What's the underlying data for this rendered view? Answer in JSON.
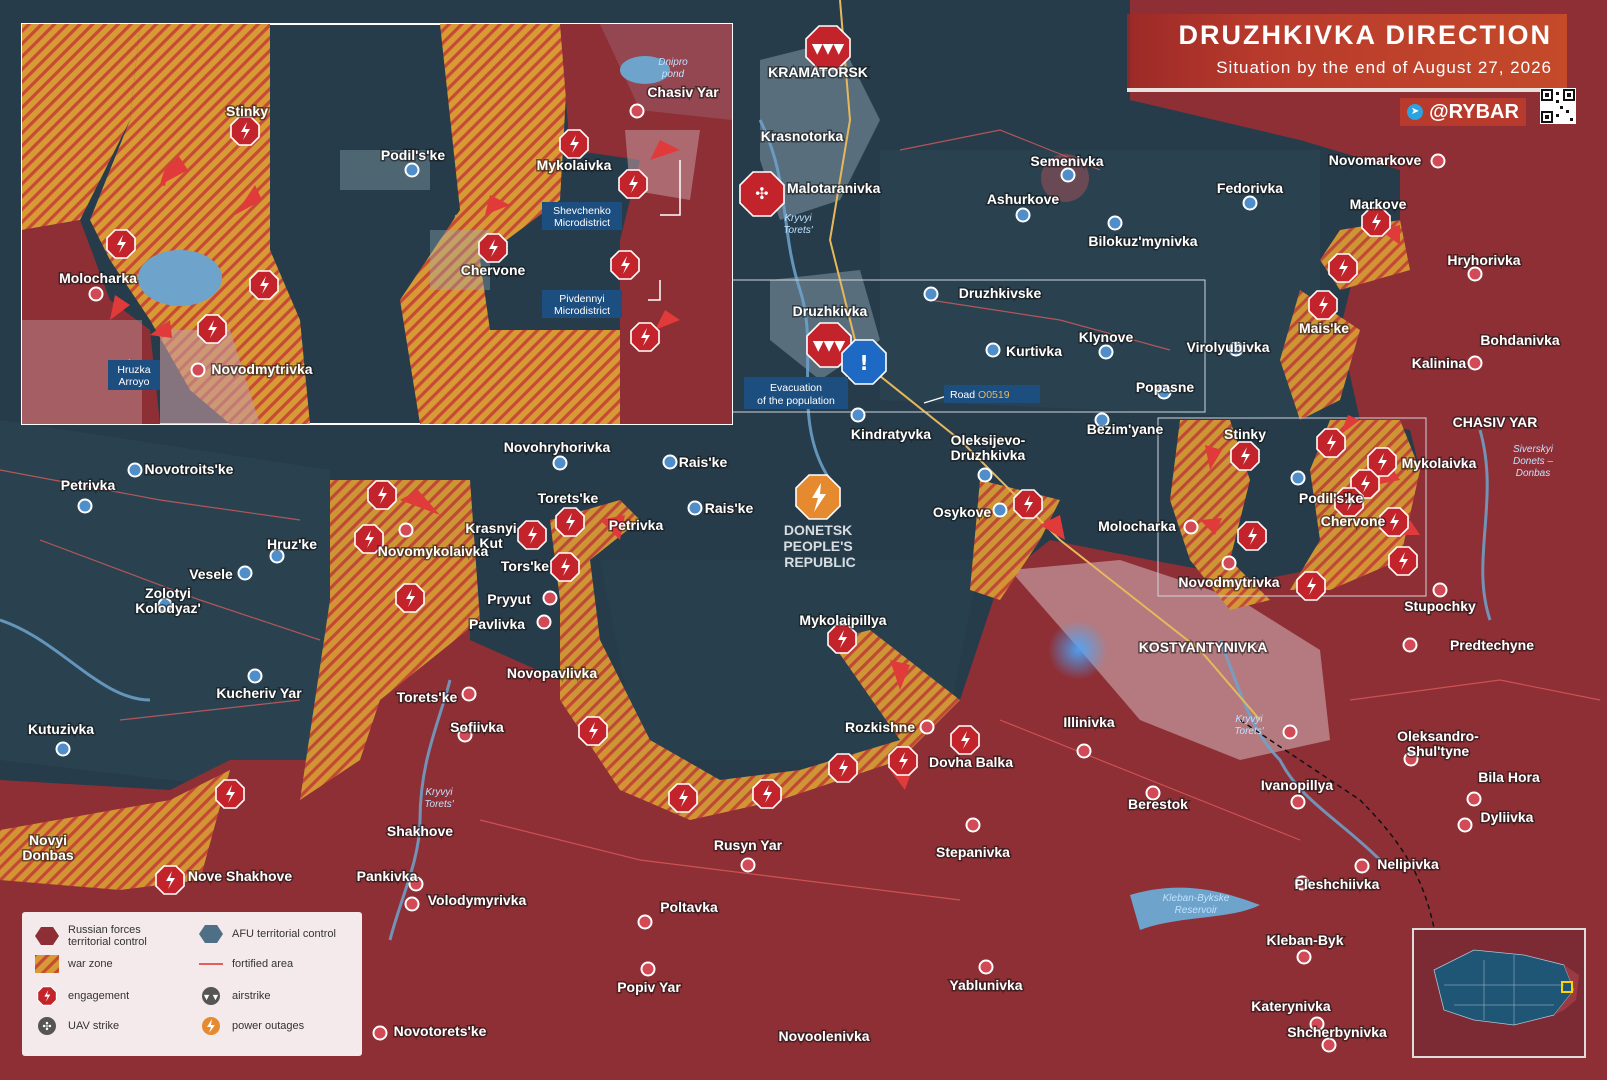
{
  "header": {
    "title": "DRUZHKIVKA DIRECTION",
    "subtitle": "Situation by the end of August 27, 2026"
  },
  "brand": {
    "handle": "@RYBAR",
    "icon": "telegram-icon"
  },
  "colors": {
    "russian_control": "#8e2f35",
    "afu_control": "#263c4a",
    "war_zone_a": "#d79a34",
    "war_zone_b": "#c64a35",
    "engagement": "#c3242b",
    "header_bg": "#b83a2c",
    "water": "#6ea3cc"
  },
  "region_label": "DONETSK\nPEOPLE'S\nREPUBLIC",
  "callouts": {
    "evacuation": "Evacuation\nof the population",
    "road_prefix": "Road ",
    "road_code": "O0519",
    "hruzka": "Hruzka\nArroyo",
    "shevchenko": "Shevchenko\nMicrodistrict",
    "pivdennyi": "Pivdennyi\nMicrodistrict"
  },
  "water_labels": {
    "dnipro_pond": "Dnipro\npond",
    "kryvyi_torets": "Kryvyi\nTorets'",
    "kleban_byk": "Kleban-Bykske\nReservoir",
    "siverskyi_donbas": "Siverskyi\nDonets –\nDonbas"
  },
  "map_labels": [
    "KRAMATORSK",
    "Krasnotorka",
    "Malotaranivka",
    "Semenivka",
    "Ashurkove",
    "Fedorivka",
    "Novomarkove",
    "Markove",
    "Bilokuz'mynivka",
    "Hryhorivka",
    "Druzhkivske",
    "Druzhkivka",
    "Kurtivka",
    "Klynove",
    "Virolyubivka",
    "Mais'ke",
    "Bohdanivka",
    "Kalinina",
    "CHASIV YAR",
    "Popasne",
    "Bezim'yane",
    "Kindratyvka",
    "Oleksijevo-\nDruzhkivka",
    "Osykove",
    "Stinky",
    "Mykolaivka",
    "Podil's'ke",
    "Chervone",
    "Molocharka",
    "Novodmytrivka",
    "Stupochky",
    "Predtechyne",
    "KOSTYANTYNIVKA",
    "Novohryhorivka",
    "Rais'ke",
    "Rais'ke",
    "Torets'ke",
    "Petrivka",
    "Krasnyi\nKut",
    "Tors'ke",
    "Novomykolaivka",
    "Novotroits'ke",
    "Petrivka",
    "Hruz'ke",
    "Vesele",
    "Zolotyi\nKolodyaz'",
    "Pryyut",
    "Pavlivka",
    "Novopavlivka",
    "Kucheriv Yar",
    "Torets'ke",
    "Sofiivka",
    "Kutuzivka",
    "Mykolaipillya",
    "Rozkishne",
    "Dovha Balka",
    "Illinivka",
    "Oleksandro-\nShul'tyne",
    "Bila Hora",
    "Ivanopillya",
    "Berestok",
    "Dyliivka",
    "Stepanivka",
    "Rusyn Yar",
    "Shakhove",
    "Pankivka",
    "Volodymyrivka",
    "Novyi\nDonbas",
    "Nove Shakhove",
    "Poltavka",
    "Nelipivka",
    "Pleshchiivka",
    "Kleban-Byk",
    "Popiv Yar",
    "Yablunivka",
    "Katerynivka",
    "Shcherbynivka",
    "Novoolenivka",
    "Novotorets'ke"
  ],
  "inset_labels": [
    "Stinky",
    "Podil's'ke",
    "Mykolaivka",
    "Chasiv Yar",
    "Chervone",
    "Molocharka",
    "Novodmytrivka"
  ],
  "legend": {
    "items": [
      {
        "label": "Russian forces\nterritorial control",
        "icon": "russian-control-swatch"
      },
      {
        "label": "AFU territorial control",
        "icon": "afu-control-swatch"
      },
      {
        "label": "war zone",
        "icon": "war-zone-swatch"
      },
      {
        "label": "fortified area",
        "icon": "fortified-line"
      },
      {
        "label": "engagement",
        "icon": "engagement-icon"
      },
      {
        "label": "airstrike",
        "icon": "airstrike-icon"
      },
      {
        "label": "UAV strike",
        "icon": "uav-icon"
      },
      {
        "label": "power outages",
        "icon": "power-outage-icon"
      }
    ]
  }
}
